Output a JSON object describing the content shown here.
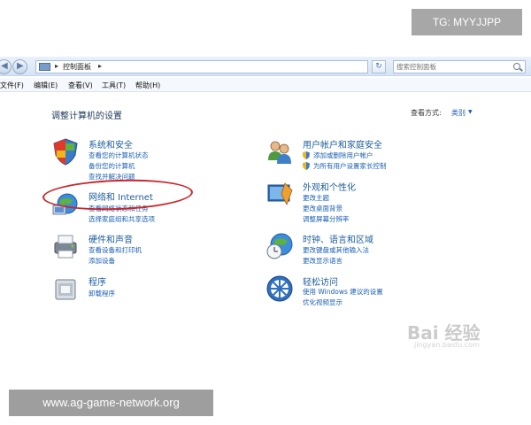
{
  "address": {
    "path_item": "控制面板",
    "search_placeholder": "搜索控制面板"
  },
  "menu": [
    "文件(F)",
    "编辑(E)",
    "查看(V)",
    "工具(T)",
    "帮助(H)"
  ],
  "content": {
    "heading": "调整计算机的设置",
    "view_by_label": "查看方式:",
    "view_by_value": "类别"
  },
  "categories_left": [
    {
      "title": "系统和安全",
      "icon": "shield-flag-icon",
      "links": [
        "查看您的计算机状态",
        "备份您的计算机",
        "查找并解决问题"
      ]
    },
    {
      "title": "网络和 Internet",
      "icon": "network-globe-icon",
      "links": [
        "查看网络状态和任务",
        "选择家庭组和共享选项"
      ]
    },
    {
      "title": "硬件和声音",
      "icon": "printer-icon",
      "links": [
        "查看设备和打印机",
        "添加设备"
      ]
    },
    {
      "title": "程序",
      "icon": "programs-icon",
      "links": [
        "卸载程序"
      ]
    }
  ],
  "categories_right": [
    {
      "title": "用户帐户和家庭安全",
      "icon": "users-icon",
      "links": [
        "添加或删除用户帐户",
        "为所有用户设置家长控制"
      ]
    },
    {
      "title": "外观和个性化",
      "icon": "appearance-icon",
      "links": [
        "更改主题",
        "更改桌面背景",
        "调整屏幕分辨率"
      ]
    },
    {
      "title": "时钟、语言和区域",
      "icon": "clock-globe-icon",
      "links": [
        "更改键盘或其他输入法",
        "更改显示语言"
      ]
    },
    {
      "title": "轻松访问",
      "icon": "ease-of-access-icon",
      "links": [
        "使用 Windows 建议的设置",
        "优化视频显示"
      ]
    }
  ],
  "overlays": {
    "tg_badge": "TG: MYYJJPP",
    "site_badge": "www.ag-game-network.org",
    "watermark": "Bai 经验",
    "watermark_sub": "jingyan.baidu.com"
  },
  "colors": {
    "link": "#1a5fb4",
    "title": "#1e5e9b",
    "highlight_ring": "#c8262b"
  }
}
